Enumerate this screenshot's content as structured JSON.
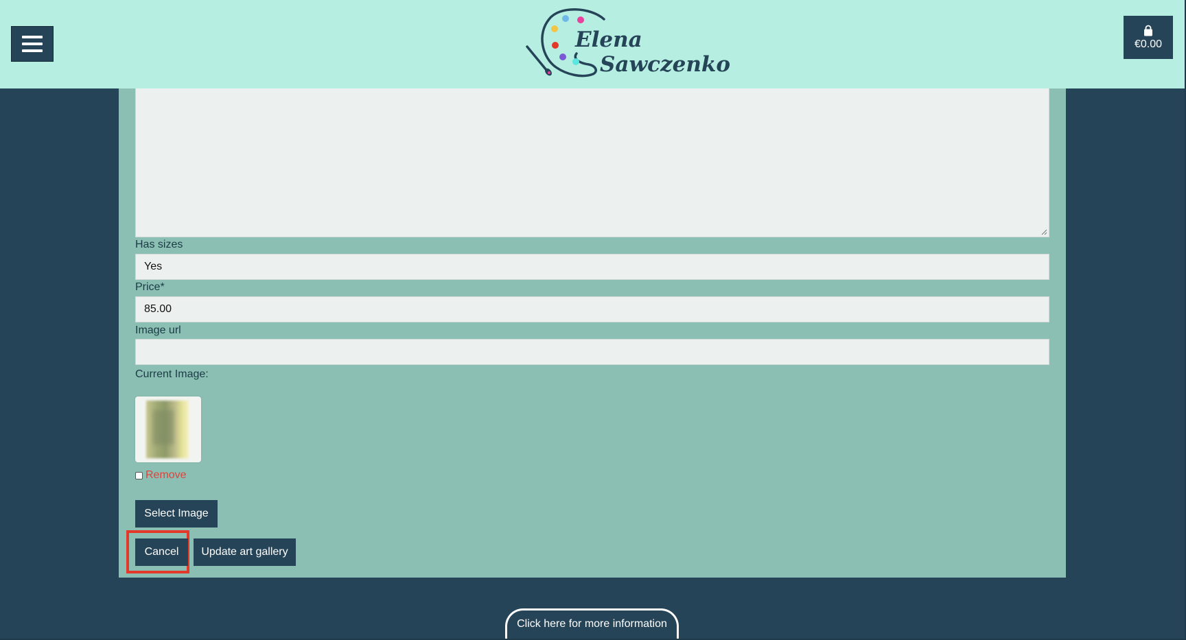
{
  "header": {
    "brand_first": "Elena",
    "brand_last": "Sawczenko",
    "cart_total": "€0.00",
    "icons": [
      "hamburger-menu-icon",
      "palette-logo-icon",
      "shopping-bag-icon"
    ]
  },
  "form": {
    "has_sizes_label": "Has sizes",
    "has_sizes_value": "Yes",
    "price_label": "Price*",
    "price_value": "85.00",
    "image_url_label": "Image url",
    "image_url_value": "",
    "current_image_label": "Current Image:",
    "remove_label": "Remove",
    "select_image_label": "Select Image",
    "cancel_label": "Cancel",
    "update_label": "Update art gallery"
  },
  "footer": {
    "info_label": "Click here for more information"
  },
  "colors": {
    "header_bg": "#b6efe2",
    "page_bg": "#264457",
    "panel_bg": "#8cbfb3",
    "button_bg": "#264457",
    "remove_text": "#e0423a",
    "highlight": "#e2392b"
  }
}
